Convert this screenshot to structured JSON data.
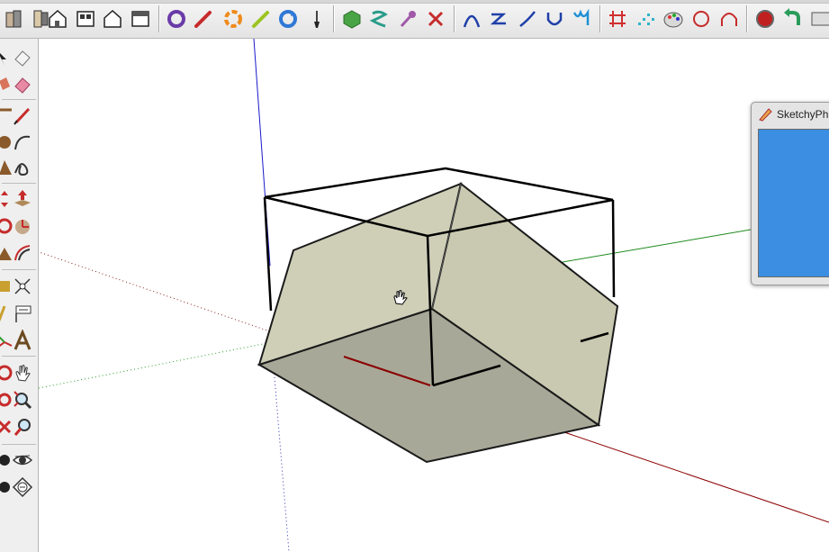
{
  "toolbar": {
    "items": [
      "rotate-orange-icon",
      "pencil-red-icon",
      "offset-orange-icon",
      "pencil-yellow-icon",
      "refresh-blue-icon",
      "paintbrush-icon"
    ]
  },
  "dialog": {
    "title": "SketchyPh"
  },
  "colors": {
    "viewport_bg": "#ffffff",
    "face_light": "#cfcfb8",
    "face_dark": "#a8a898",
    "dialog_content": "#3b8ee1",
    "axis_blue": "#1a1acc",
    "axis_red": "#8b0000",
    "axis_green": "#1e8a1e"
  }
}
